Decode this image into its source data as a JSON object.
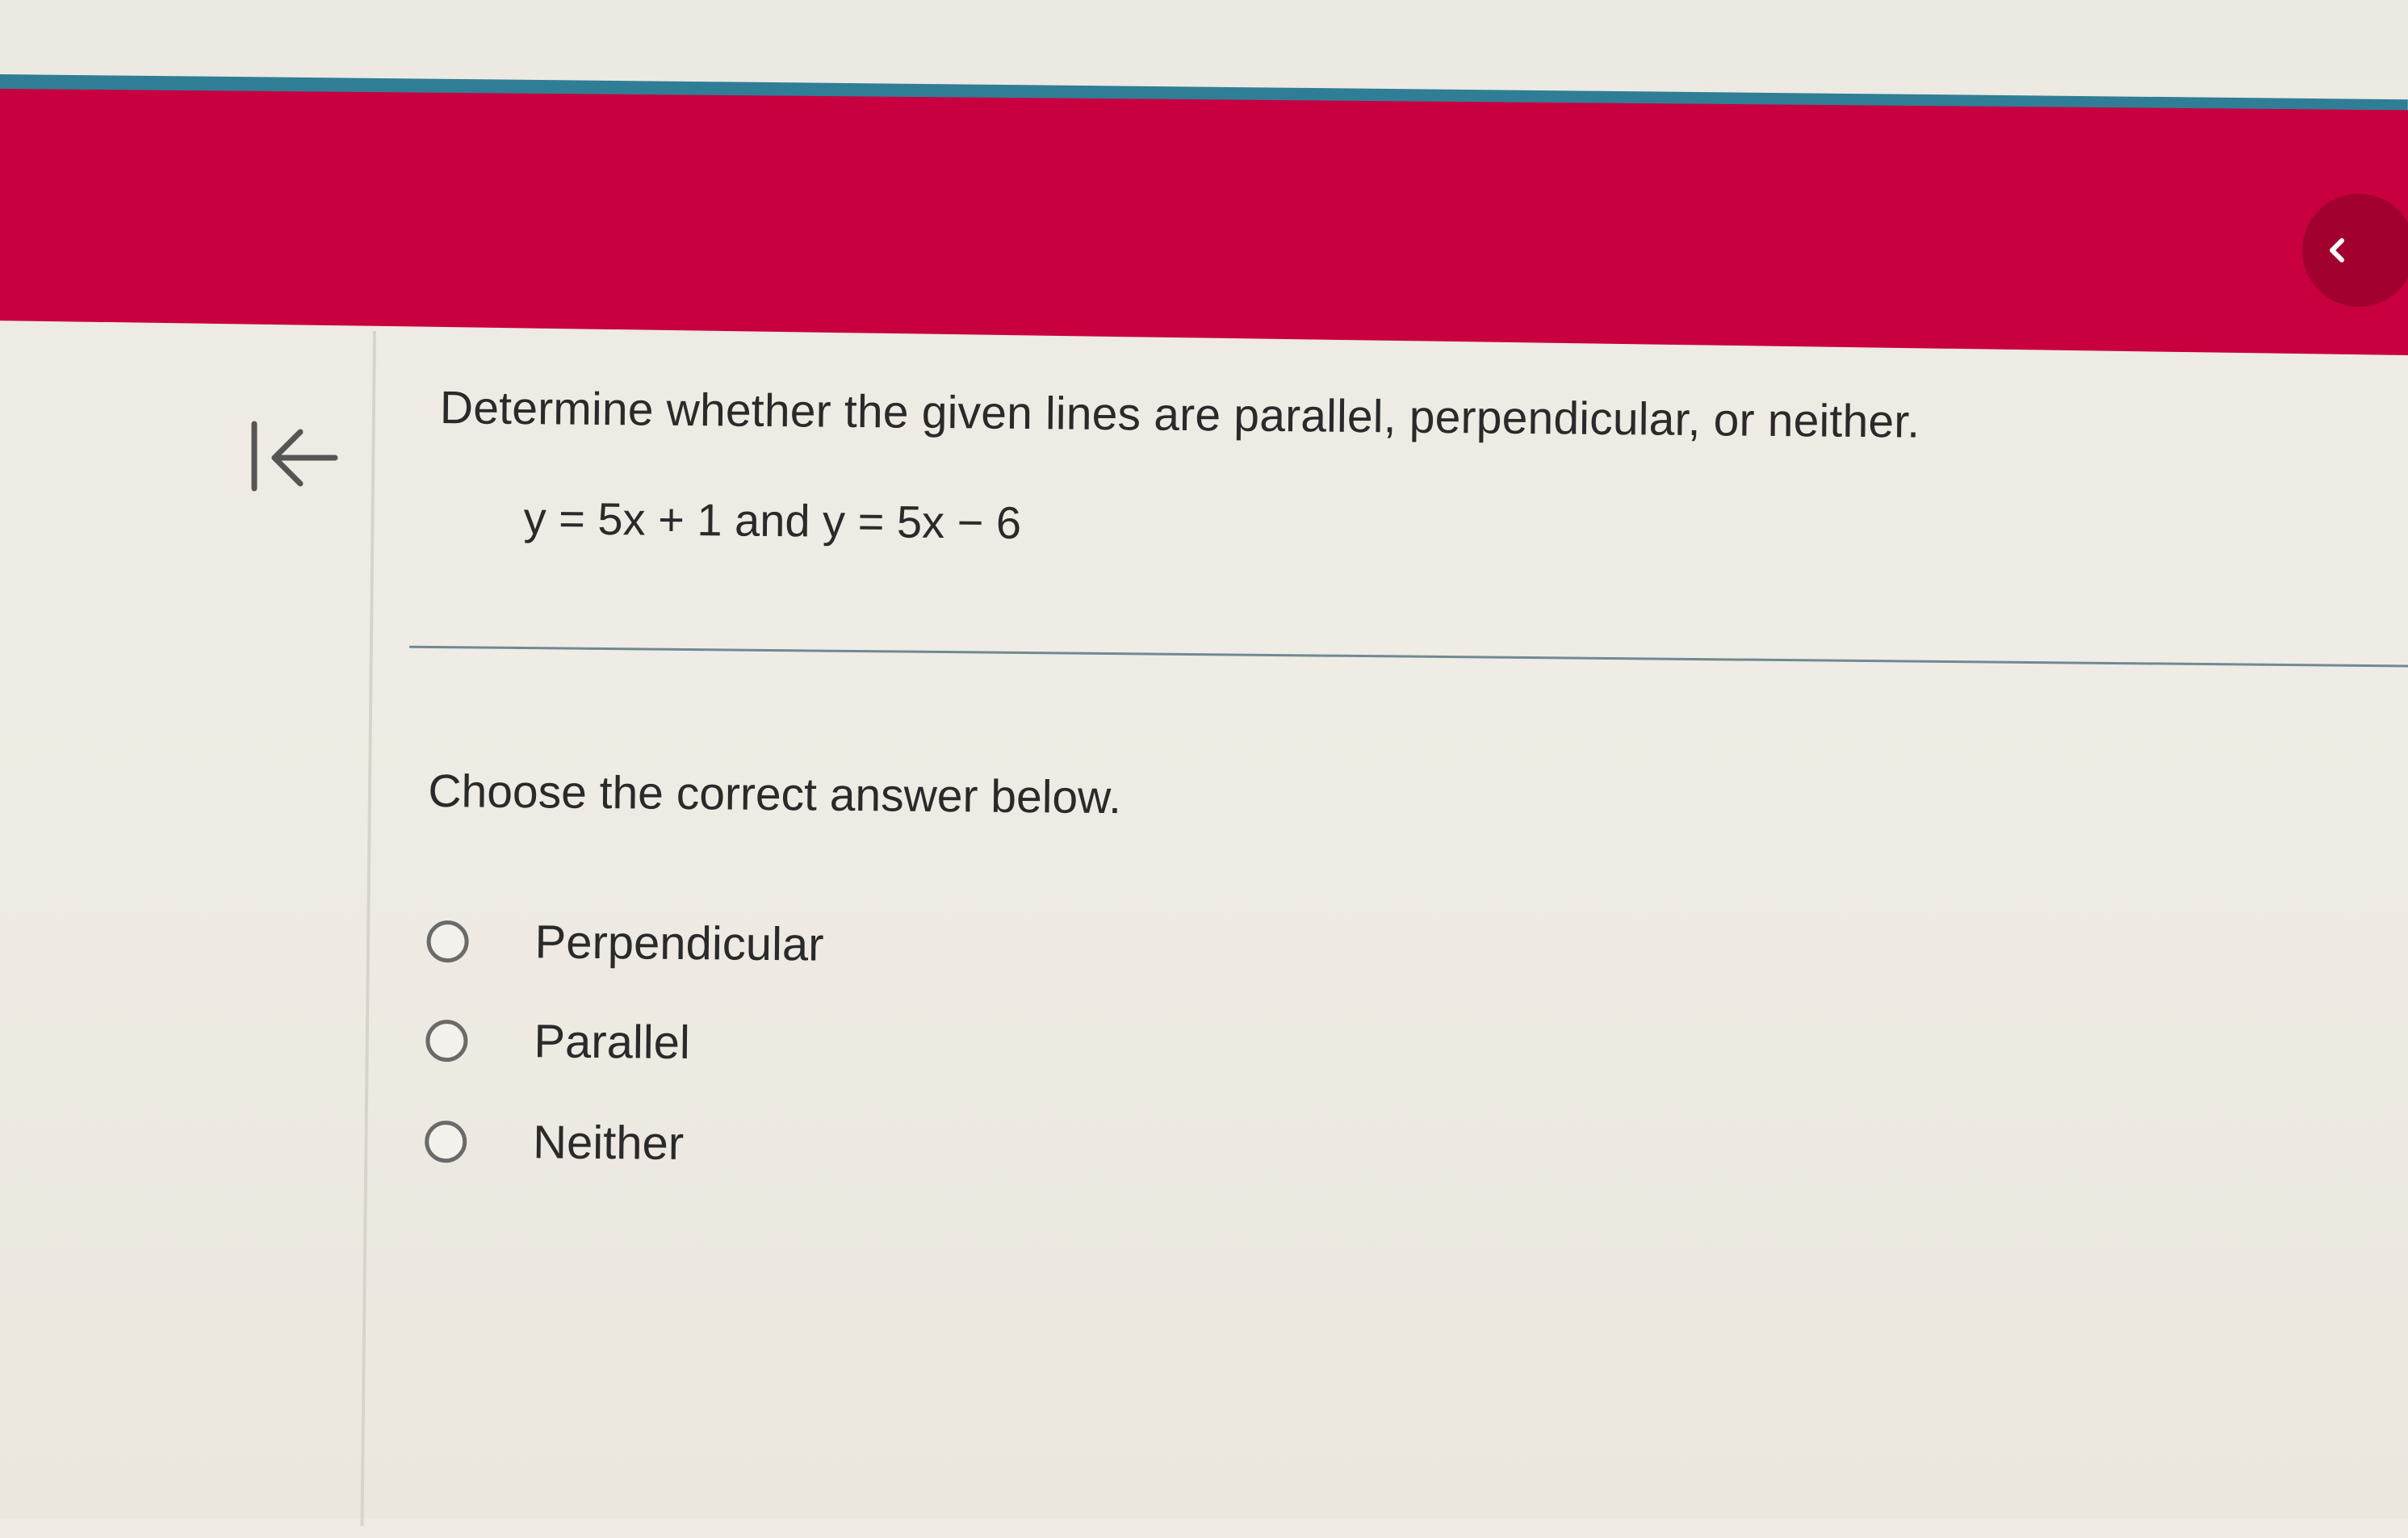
{
  "header": {
    "accent_color": "#c80040",
    "line_color": "#2f7e96",
    "collapse_icon": "chevron-left-icon"
  },
  "navigation": {
    "back_icon": "arrow-left-to-line-icon"
  },
  "question": {
    "prompt": "Determine whether the given lines are parallel, perpendicular, or neither.",
    "equations": "y = 5x + 1 and y = 5x − 6"
  },
  "answer": {
    "instruction": "Choose the correct answer below.",
    "options": [
      {
        "label": "Perpendicular"
      },
      {
        "label": "Parallel"
      },
      {
        "label": "Neither"
      }
    ]
  }
}
